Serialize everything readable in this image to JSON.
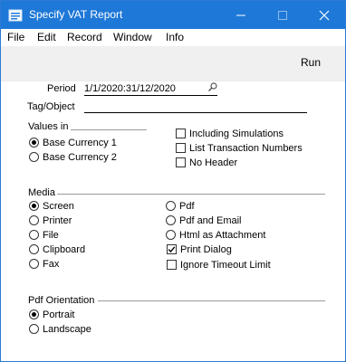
{
  "window": {
    "title": "Specify VAT Report"
  },
  "menu": [
    "File",
    "Edit",
    "Record",
    "Window",
    "Info"
  ],
  "toolbar": {
    "run_label": "Run"
  },
  "form": {
    "period_label": "Period",
    "period_value": "1/1/2020:31/12/2020",
    "tag_label": "Tag/Object",
    "tag_value": ""
  },
  "values_in": {
    "heading": "Values in",
    "options": [
      "Base Currency 1",
      "Base Currency 2"
    ],
    "selected": "Base Currency 1"
  },
  "checkboxes_top": [
    {
      "label": "Including Simulations",
      "checked": false
    },
    {
      "label": "List Transaction Numbers",
      "checked": false
    },
    {
      "label": "No Header",
      "checked": false
    }
  ],
  "media": {
    "heading": "Media",
    "left_options": [
      "Screen",
      "Printer",
      "File",
      "Clipboard",
      "Fax"
    ],
    "right_options": [
      "Pdf",
      "Pdf and Email",
      "Html as Attachment"
    ],
    "selected": "Screen",
    "print_dialog": {
      "label": "Print Dialog",
      "checked": true
    },
    "ignore_timeout": {
      "label": "Ignore Timeout Limit",
      "checked": false
    }
  },
  "pdf_orientation": {
    "heading": "Pdf Orientation",
    "options": [
      "Portrait",
      "Landscape"
    ],
    "selected": "Portrait"
  }
}
